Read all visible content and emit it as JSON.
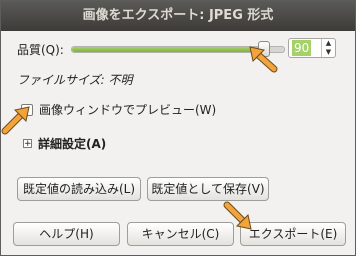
{
  "window": {
    "title": "画像をエクスポート: JPEG 形式"
  },
  "quality": {
    "label": "品質(Q):",
    "value": "90",
    "slider_fraction": 0.9
  },
  "file_size": {
    "label": "ファイルサイズ: 不明"
  },
  "preview": {
    "label": "画像ウィンドウでプレビュー(W)",
    "checked": false
  },
  "advanced": {
    "label": "詳細設定(A)",
    "expander_symbol": "+"
  },
  "buttons": {
    "load_defaults": "既定値の読み込み(L)",
    "save_defaults": "既定値として保存(V)",
    "help": "ヘルプ(H)",
    "cancel": "キャンセル(C)",
    "export": "エクスポート(E)"
  },
  "spin_icons": {
    "up": "▲",
    "down": "▼"
  },
  "colors": {
    "accent_green": "#8cc04f",
    "arrow_orange": "#f2a33c",
    "titlebar": "#3d3c38"
  }
}
